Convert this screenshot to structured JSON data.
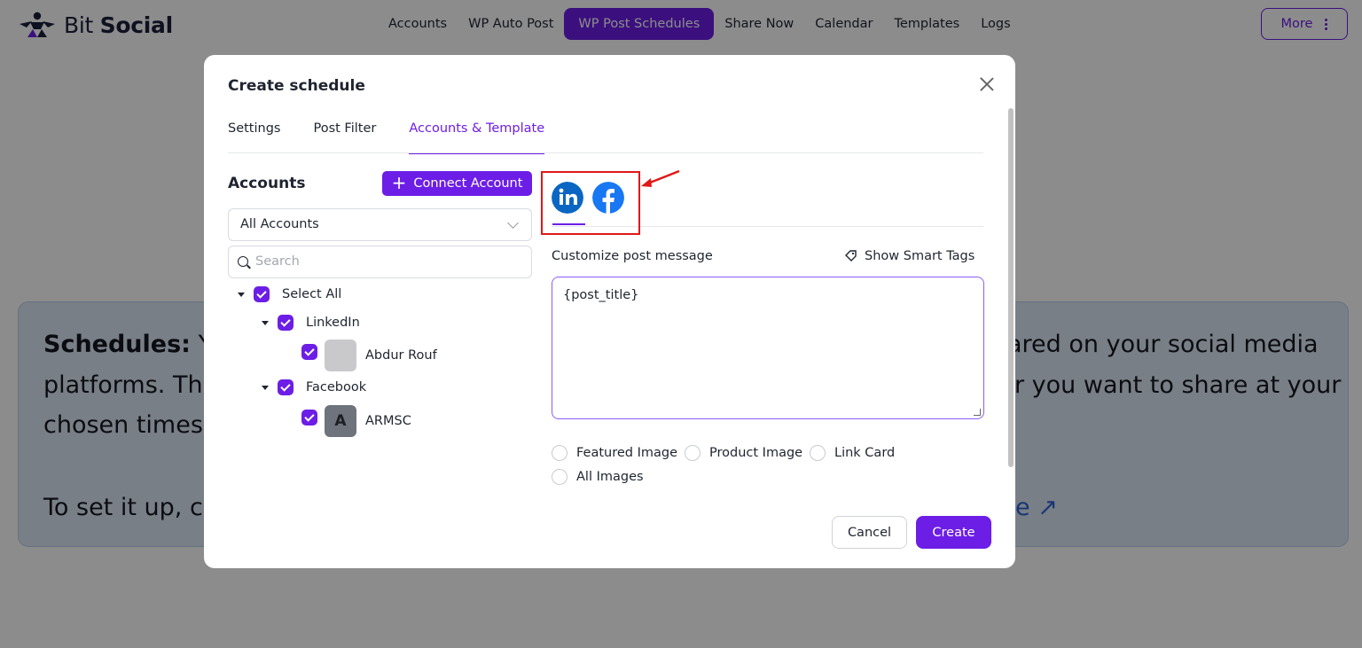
{
  "brand": {
    "name_light": "Bit",
    "name_bold": "Social",
    "color": "#6c1ee6"
  },
  "nav": {
    "items": [
      "Accounts",
      "WP Auto Post",
      "WP Post Schedules",
      "Share Now",
      "Calendar",
      "Templates",
      "Logs"
    ],
    "active": "WP Post Schedules",
    "more_label": "More"
  },
  "info": {
    "heading": "Schedules:",
    "line1_left": "Yo",
    "line1_right": "ared on your social media",
    "line2_left": "platforms. Thi",
    "line2_right": "r you want to share at your",
    "line3": "chosen times.",
    "line4_left": "To set it up, cli",
    "link_fragment": "e ↗"
  },
  "modal": {
    "title": "Create schedule",
    "tabs": [
      "Settings",
      "Post Filter",
      "Accounts & Template"
    ],
    "active_tab": "Accounts & Template",
    "accounts_title": "Accounts",
    "connect_label": "Connect Account",
    "filter_value": "All Accounts",
    "search_placeholder": "Search",
    "tree": {
      "select_all": "Select All",
      "groups": [
        {
          "name": "LinkedIn",
          "accounts": [
            {
              "name": "Abdur Rouf",
              "avatar": ""
            }
          ]
        },
        {
          "name": "Facebook",
          "accounts": [
            {
              "name": "ARMSC",
              "avatar": "A"
            }
          ]
        }
      ]
    },
    "social_tabs": [
      "linkedin-icon",
      "facebook-icon"
    ],
    "customize_label": "Customize post message",
    "smart_tags_label": "Show Smart Tags",
    "message": "{post_title}",
    "options": [
      "Featured Image",
      "Product Image",
      "Link Card",
      "All Images"
    ],
    "cancel_label": "Cancel",
    "create_label": "Create"
  }
}
